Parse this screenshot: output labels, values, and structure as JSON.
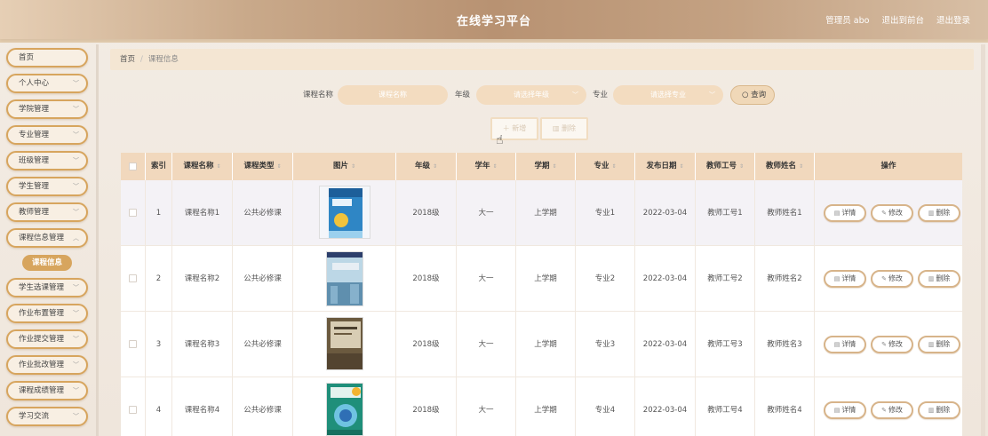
{
  "header": {
    "title": "在线学习平台",
    "links": [
      "管理员 abo",
      "退出到前台",
      "退出登录"
    ]
  },
  "sidebar": {
    "items": [
      {
        "label": "首页",
        "chevron": false
      },
      {
        "label": "个人中心",
        "chevron": true
      },
      {
        "label": "学院管理",
        "chevron": true
      },
      {
        "label": "专业管理",
        "chevron": true
      },
      {
        "label": "班级管理",
        "chevron": true
      },
      {
        "label": "学生管理",
        "chevron": true
      },
      {
        "label": "教师管理",
        "chevron": true
      },
      {
        "label": "课程信息管理",
        "chevron": true
      },
      {
        "label": "学生选课管理",
        "chevron": true
      },
      {
        "label": "作业布置管理",
        "chevron": true
      },
      {
        "label": "作业提交管理",
        "chevron": true
      },
      {
        "label": "作业批改管理",
        "chevron": true
      },
      {
        "label": "课程成绩管理",
        "chevron": true
      },
      {
        "label": "学习交流",
        "chevron": true
      }
    ],
    "active_sub": "课程信息"
  },
  "breadcrumb": {
    "home": "首页",
    "separator": "/",
    "current": "课程信息"
  },
  "search": {
    "course_label": "课程名称",
    "course_placeholder": "课程名称",
    "grade_label": "年级",
    "grade_placeholder": "请选择年级",
    "major_label": "专业",
    "major_placeholder": "请选择专业",
    "query_label": "查询"
  },
  "actions": {
    "add_label": "新增",
    "delete_label": "删除"
  },
  "table": {
    "columns": [
      "索引",
      "课程名称",
      "课程类型",
      "图片",
      "年级",
      "学年",
      "学期",
      "专业",
      "发布日期",
      "教师工号",
      "教师姓名",
      "操作"
    ],
    "rows": [
      {
        "index": "1",
        "name": "课程名称1",
        "type": "公共必修课",
        "grade": "2018级",
        "year": "大一",
        "term": "上学期",
        "major": "专业1",
        "date": "2022-03-04",
        "teacher_id": "教师工号1",
        "teacher_name": "教师姓名1"
      },
      {
        "index": "2",
        "name": "课程名称2",
        "type": "公共必修课",
        "grade": "2018级",
        "year": "大一",
        "term": "上学期",
        "major": "专业2",
        "date": "2022-03-04",
        "teacher_id": "教师工号2",
        "teacher_name": "教师姓名2"
      },
      {
        "index": "3",
        "name": "课程名称3",
        "type": "公共必修课",
        "grade": "2018级",
        "year": "大一",
        "term": "上学期",
        "major": "专业3",
        "date": "2022-03-04",
        "teacher_id": "教师工号3",
        "teacher_name": "教师姓名3"
      },
      {
        "index": "4",
        "name": "课程名称4",
        "type": "公共必修课",
        "grade": "2018级",
        "year": "大一",
        "term": "上学期",
        "major": "专业4",
        "date": "2022-03-04",
        "teacher_id": "教师工号4",
        "teacher_name": "教师姓名4"
      }
    ],
    "ops": {
      "detail": "详情",
      "edit": "修改",
      "remove": "删除"
    }
  },
  "colors": {
    "accent": "#d7a55e",
    "header_bg": "#b89272",
    "table_head": "#f1d8bd"
  }
}
